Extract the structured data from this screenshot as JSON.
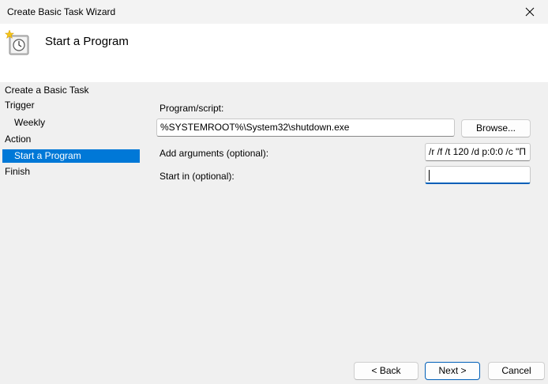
{
  "window": {
    "title": "Create Basic Task Wizard"
  },
  "header": {
    "title": "Start a Program"
  },
  "nav": {
    "items": [
      {
        "label": "Create a Basic Task"
      },
      {
        "label": "Trigger"
      },
      {
        "label": "Weekly"
      },
      {
        "label": "Action"
      },
      {
        "label": "Start a Program"
      },
      {
        "label": "Finish"
      }
    ]
  },
  "form": {
    "program_label": "Program/script:",
    "program_value": "%SYSTEMROOT%\\System32\\shutdown.exe",
    "browse_label": "Browse...",
    "args_label": "Add arguments (optional):",
    "args_value": "/r /f /t 120 /d p:0:0 /c \"П",
    "startin_label": "Start in (optional):",
    "startin_value": ""
  },
  "footer": {
    "back_label": "< Back",
    "next_label": "Next >",
    "cancel_label": "Cancel"
  },
  "colors": {
    "accent": "#0078d7",
    "focus": "#005fb8"
  },
  "icons": {
    "close": "close-icon",
    "task": "task-clock-icon"
  }
}
